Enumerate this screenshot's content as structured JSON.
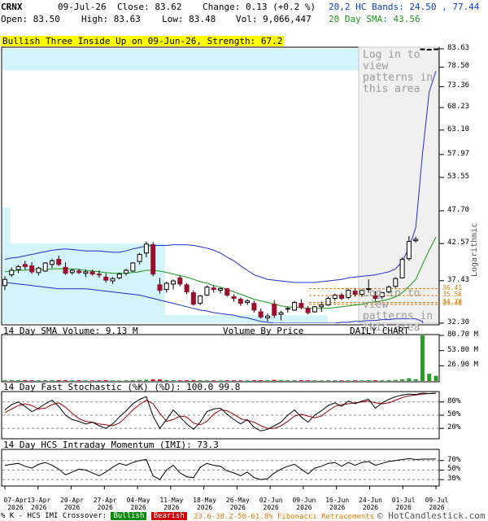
{
  "header": {
    "symbol": "CRNX",
    "date": "09-Jul-26",
    "close": "Close: 83.62",
    "change": "Change: 0.13 (+0.2 %)",
    "open": "Open: 83.50",
    "high": "High: 83.63",
    "low": "Low: 83.48",
    "volume": "Vol: 9,066,447",
    "bands": "20,2 HC Bands: 24.50 , 77.44",
    "sma": "20 Day SMA: 43.56"
  },
  "pattern_banner": "Bullish Three Inside Up on 09-Jun-26, Strength: 67.2",
  "login_note_1": "Log in to view patterns in this area",
  "login_note_2": "Log in to view patterns in this area",
  "scale_note": "Logarithmic",
  "price_panel": {
    "ylabels": [
      "83.63",
      "78.50",
      "73.36",
      "68.23",
      "63.10",
      "57.97",
      "53.55",
      "47.70",
      "42.57",
      "37.43",
      "32.30"
    ],
    "fib_labels": [
      "36.41",
      "35.56",
      "34.70",
      "34.48"
    ],
    "footer_left": "14 Day SMA Volume: 9.13 M",
    "footer_mid": "Volume By Price",
    "footer_right": "DAILY CHART"
  },
  "volume_panel": {
    "ylabels": [
      "80.70 M",
      "53.80 M",
      "26.90 M"
    ]
  },
  "stoch_panel": {
    "title": "14 Day Fast Stochastic (%K) (%D): 100.0 99.8",
    "ylabels": [
      "80%",
      "50%",
      "20%"
    ]
  },
  "imi_panel": {
    "title": "14 Day HCS Intraday Momentum (IMI): 73.3",
    "ylabels": [
      "70%",
      "50%",
      "30%"
    ]
  },
  "x_axis": {
    "labels": [
      "07-Apr 2026",
      "13-Apr 2026",
      "20-Apr 2026",
      "27-Apr 2026",
      "04-May 2026",
      "11-May 2026",
      "18-May 2026",
      "26-May 2026",
      "02-Jun 2026",
      "09-Jun 2026",
      "16-Jun 2026",
      "24-Jun 2026",
      "01-Jul 2026",
      "09-Jul 2026"
    ]
  },
  "footer": {
    "legend_prefix": "% K - HCS IMI Crossover:",
    "bullish": "Bullish",
    "bearish": "Bearish",
    "fib": "23.6-38.2-50-61.8% Fibonacci Retracements",
    "copyright": "© HotCandlestick.com"
  },
  "chart_data": {
    "type": "candlestick",
    "symbol": "CRNX",
    "y_scale": "log",
    "ylim": [
      32.3,
      83.63
    ],
    "dates": [
      "07-Apr",
      "08-Apr",
      "09-Apr",
      "10-Apr",
      "13-Apr",
      "14-Apr",
      "15-Apr",
      "16-Apr",
      "17-Apr",
      "20-Apr",
      "21-Apr",
      "22-Apr",
      "23-Apr",
      "24-Apr",
      "27-Apr",
      "28-Apr",
      "29-Apr",
      "30-Apr",
      "01-May",
      "04-May",
      "05-May",
      "06-May",
      "07-May",
      "08-May",
      "11-May",
      "12-May",
      "13-May",
      "14-May",
      "15-May",
      "18-May",
      "19-May",
      "20-May",
      "21-May",
      "22-May",
      "26-May",
      "27-May",
      "28-May",
      "29-May",
      "01-Jun",
      "02-Jun",
      "03-Jun",
      "04-Jun",
      "05-Jun",
      "08-Jun",
      "09-Jun",
      "10-Jun",
      "11-Jun",
      "12-Jun",
      "15-Jun",
      "16-Jun",
      "17-Jun",
      "18-Jun",
      "22-Jun",
      "23-Jun",
      "24-Jun",
      "25-Jun",
      "26-Jun",
      "29-Jun",
      "30-Jun",
      "01-Jul",
      "02-Jul",
      "06-Jul",
      "07-Jul",
      "08-Jul",
      "09-Jul"
    ],
    "candles": [
      [
        36.8,
        38.0,
        36.2,
        37.6
      ],
      [
        38.2,
        39.2,
        37.9,
        38.8
      ],
      [
        38.9,
        39.5,
        38.4,
        39.3
      ],
      [
        39.6,
        40.1,
        38.9,
        39.3
      ],
      [
        39.4,
        39.9,
        38.3,
        38.6
      ],
      [
        38.5,
        39.3,
        38.1,
        39.1
      ],
      [
        38.7,
        39.9,
        38.6,
        39.8
      ],
      [
        39.6,
        40.4,
        39.1,
        40.1
      ],
      [
        40.3,
        40.8,
        39.4,
        39.6
      ],
      [
        39.2,
        39.9,
        38.2,
        38.4
      ],
      [
        38.5,
        39.0,
        38.2,
        38.8
      ],
      [
        38.7,
        39.0,
        38.3,
        38.5
      ],
      [
        38.4,
        38.9,
        37.9,
        38.6
      ],
      [
        38.6,
        38.9,
        38.1,
        38.3
      ],
      [
        38.3,
        38.8,
        37.8,
        38.2
      ],
      [
        37.9,
        38.4,
        37.2,
        37.5
      ],
      [
        37.4,
        37.9,
        37.0,
        37.7
      ],
      [
        37.8,
        38.5,
        37.6,
        38.3
      ],
      [
        38.4,
        39.0,
        38.1,
        38.8
      ],
      [
        38.7,
        39.9,
        38.6,
        39.8
      ],
      [
        40.0,
        41.2,
        39.6,
        41.0
      ],
      [
        41.2,
        42.9,
        40.6,
        42.5
      ],
      [
        42.4,
        42.8,
        38.0,
        38.3
      ],
      [
        36.9,
        37.8,
        35.8,
        36.2
      ],
      [
        36.3,
        37.3,
        35.9,
        37.1
      ],
      [
        37.0,
        37.6,
        36.3,
        37.4
      ],
      [
        37.8,
        38.1,
        36.7,
        37.0
      ],
      [
        36.9,
        37.1,
        35.7,
        36.0
      ],
      [
        35.9,
        36.2,
        34.3,
        34.5
      ],
      [
        34.6,
        35.6,
        34.4,
        35.5
      ],
      [
        35.6,
        36.8,
        35.5,
        36.6
      ],
      [
        36.5,
        36.8,
        35.9,
        36.3
      ],
      [
        36.2,
        36.6,
        35.8,
        36.4
      ],
      [
        36.4,
        36.5,
        35.4,
        35.6
      ],
      [
        35.4,
        35.7,
        34.8,
        35.2
      ],
      [
        35.1,
        35.3,
        34.3,
        34.6
      ],
      [
        34.7,
        35.1,
        34.4,
        34.9
      ],
      [
        34.6,
        34.9,
        33.5,
        33.8
      ],
      [
        33.6,
        34.0,
        32.8,
        33.0
      ],
      [
        32.9,
        33.4,
        32.5,
        33.1
      ],
      [
        34.5,
        35.0,
        32.9,
        33.2
      ],
      [
        33.3,
        33.7,
        32.6,
        33.5
      ],
      [
        33.9,
        34.2,
        33.5,
        34.0
      ],
      [
        33.8,
        34.9,
        33.7,
        34.7
      ],
      [
        34.6,
        35.1,
        33.9,
        34.1
      ],
      [
        34.0,
        34.3,
        33.3,
        33.5
      ],
      [
        33.6,
        34.3,
        33.5,
        34.2
      ],
      [
        34.2,
        34.8,
        33.6,
        34.4
      ],
      [
        34.4,
        35.4,
        34.3,
        35.2
      ],
      [
        35.2,
        35.8,
        34.9,
        35.6
      ],
      [
        35.6,
        35.9,
        35.0,
        35.2
      ],
      [
        35.3,
        36.4,
        35.1,
        36.2
      ],
      [
        36.1,
        36.4,
        35.4,
        35.7
      ],
      [
        35.7,
        36.3,
        35.4,
        36.2
      ],
      [
        36.3,
        37.6,
        35.9,
        36.4
      ],
      [
        35.5,
        36.1,
        34.9,
        35.2
      ],
      [
        35.4,
        36.0,
        35.1,
        35.9
      ],
      [
        36.0,
        36.8,
        35.8,
        36.6
      ],
      [
        36.7,
        37.9,
        36.5,
        37.7
      ],
      [
        37.8,
        40.6,
        37.7,
        40.3
      ],
      [
        40.4,
        43.7,
        40.1,
        42.9
      ],
      [
        43.0,
        43.6,
        42.7,
        43.2
      ],
      [
        83.4,
        83.7,
        83.3,
        83.6
      ],
      [
        83.5,
        83.7,
        83.4,
        83.5
      ],
      [
        83.5,
        83.63,
        83.48,
        83.62
      ]
    ],
    "bollinger_upper": [
      40.3,
      40.5,
      40.6,
      40.8,
      41.0,
      41.2,
      41.4,
      41.6,
      41.7,
      41.8,
      41.7,
      41.6,
      41.5,
      41.5,
      41.5,
      41.4,
      41.3,
      41.3,
      41.5,
      41.8,
      42.0,
      42.2,
      42.3,
      42.3,
      42.3,
      42.4,
      42.4,
      42.4,
      42.3,
      42.1,
      41.9,
      41.6,
      41.2,
      40.6,
      40.1,
      39.4,
      38.8,
      38.2,
      37.9,
      37.6,
      37.5,
      37.4,
      37.3,
      37.2,
      37.2,
      37.2,
      37.2,
      37.3,
      37.4,
      37.5,
      37.6,
      37.8,
      37.9,
      38.0,
      38.1,
      38.2,
      38.4,
      38.6,
      39.0,
      40.0,
      42.0,
      45.0,
      58.0,
      72.0,
      77.44
    ],
    "sma20": [
      38.6,
      38.7,
      38.8,
      38.8,
      38.9,
      38.9,
      38.9,
      39.0,
      39.0,
      39.0,
      39.0,
      38.9,
      38.8,
      38.7,
      38.6,
      38.5,
      38.4,
      38.4,
      38.4,
      38.5,
      38.6,
      38.8,
      38.8,
      38.7,
      38.5,
      38.3,
      38.1,
      37.9,
      37.6,
      37.3,
      37.1,
      36.8,
      36.6,
      36.3,
      36.0,
      35.7,
      35.4,
      35.1,
      34.9,
      34.7,
      34.5,
      34.3,
      34.2,
      34.1,
      34.1,
      34.0,
      34.0,
      34.0,
      34.0,
      34.1,
      34.2,
      34.3,
      34.4,
      34.5,
      34.7,
      34.8,
      34.9,
      35.1,
      35.4,
      35.9,
      36.7,
      37.6,
      39.6,
      41.6,
      43.56
    ],
    "bollinger_lower": [
      37.2,
      37.1,
      37.0,
      36.9,
      36.8,
      36.7,
      36.6,
      36.5,
      36.4,
      36.4,
      36.4,
      36.4,
      36.4,
      36.3,
      36.2,
      36.1,
      36.0,
      35.9,
      35.8,
      35.7,
      35.6,
      35.4,
      35.2,
      35.0,
      34.8,
      34.6,
      34.4,
      34.2,
      34.0,
      33.8,
      33.7,
      33.5,
      33.4,
      33.3,
      33.2,
      33.0,
      32.9,
      32.7,
      32.5,
      32.4,
      32.3,
      32.3,
      32.3,
      32.3,
      32.3,
      32.3,
      32.3,
      32.3,
      32.3,
      32.3,
      32.4,
      32.4,
      32.5,
      32.5,
      32.6,
      32.6,
      32.7,
      32.7,
      32.8,
      32.8,
      32.8,
      32.8,
      32.5,
      29.0,
      24.5
    ],
    "volume_millions": [
      1.5,
      1.4,
      1.6,
      1.4,
      1.3,
      1.2,
      1.3,
      1.6,
      1.5,
      1.4,
      1.2,
      1.2,
      1.1,
      1.0,
      1.2,
      1.4,
      1.1,
      1.0,
      1.2,
      1.4,
      1.8,
      2.3,
      2.8,
      2.6,
      1.6,
      1.3,
      1.2,
      1.3,
      1.6,
      1.4,
      1.2,
      1.1,
      1.0,
      1.1,
      1.2,
      1.2,
      1.1,
      1.3,
      1.5,
      1.4,
      2.0,
      1.5,
      1.3,
      1.4,
      1.2,
      1.2,
      1.1,
      1.0,
      1.2,
      1.3,
      1.1,
      1.2,
      1.2,
      1.1,
      1.6,
      1.3,
      1.2,
      1.4,
      1.8,
      3.0,
      4.8,
      3.2,
      80.7,
      12.8,
      9.07
    ],
    "stochastic_k": [
      62,
      74,
      80,
      70,
      58,
      66,
      76,
      84,
      70,
      50,
      40,
      36,
      30,
      34,
      26,
      20,
      30,
      46,
      60,
      76,
      86,
      92,
      48,
      20,
      40,
      62,
      46,
      30,
      18,
      34,
      58,
      64,
      66,
      52,
      40,
      30,
      40,
      22,
      14,
      18,
      26,
      34,
      50,
      62,
      46,
      34,
      50,
      60,
      72,
      78,
      70,
      82,
      76,
      82,
      86,
      66,
      78,
      86,
      92,
      96,
      98,
      97,
      100,
      99,
      100.0
    ],
    "stochastic_d": [
      56,
      64,
      72,
      76,
      72,
      64,
      66,
      74,
      78,
      68,
      54,
      42,
      36,
      34,
      30,
      28,
      26,
      32,
      46,
      62,
      74,
      84,
      76,
      54,
      36,
      40,
      48,
      46,
      32,
      28,
      36,
      52,
      62,
      60,
      52,
      42,
      38,
      34,
      26,
      20,
      20,
      26,
      36,
      48,
      52,
      48,
      44,
      48,
      60,
      70,
      74,
      76,
      78,
      80,
      82,
      78,
      76,
      78,
      84,
      90,
      94,
      96,
      98,
      99,
      99.8
    ],
    "imi": [
      60,
      62,
      64,
      58,
      54,
      62,
      66,
      60,
      52,
      40,
      46,
      52,
      50,
      44,
      38,
      46,
      56,
      64,
      60,
      66,
      70,
      72,
      38,
      30,
      50,
      60,
      44,
      36,
      34,
      56,
      64,
      60,
      58,
      48,
      44,
      38,
      46,
      34,
      30,
      32,
      44,
      52,
      58,
      62,
      52,
      42,
      54,
      58,
      64,
      66,
      58,
      66,
      60,
      66,
      68,
      60,
      64,
      68,
      70,
      72,
      74,
      72,
      73,
      73,
      73.3
    ]
  }
}
